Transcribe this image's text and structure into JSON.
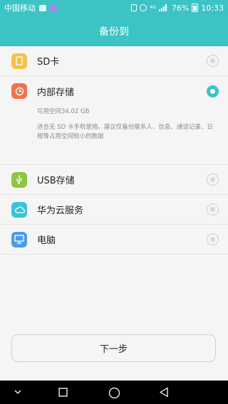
{
  "status_bar": {
    "carrier": "中国移动",
    "network": "4G",
    "battery": "76%",
    "time": "10:33"
  },
  "app_bar": {
    "title": "备份到"
  },
  "options": [
    {
      "label": "SD卡",
      "icon": "sd-card-icon",
      "color": "#f7c144",
      "selected": false
    },
    {
      "label": "内部存储",
      "icon": "internal-storage-icon",
      "color": "#ee7450",
      "selected": true,
      "free_space": "可用空间34.02 GB",
      "description": "适合无 SD 卡手机使用。建议仅备份联系人、信息、通话记录、日程等占用空间较小的数据"
    },
    {
      "label": "USB存储",
      "icon": "usb-icon",
      "color": "#8dc63f",
      "selected": false
    },
    {
      "label": "华为云服务",
      "icon": "cloud-icon",
      "color": "#3ac3dd",
      "selected": false
    },
    {
      "label": "电脑",
      "icon": "computer-icon",
      "color": "#4f9be6",
      "selected": false
    }
  ],
  "next_button": {
    "label": "下一步"
  },
  "colors": {
    "accent": "#3cc3c6"
  }
}
